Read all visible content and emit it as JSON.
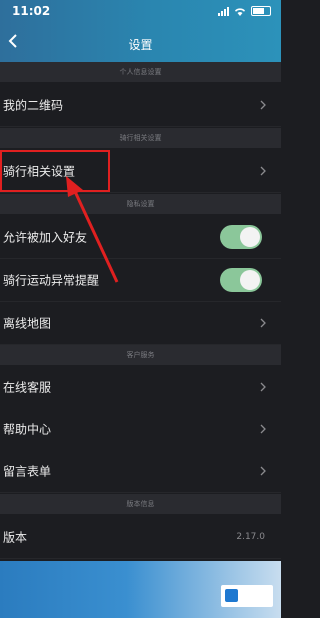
{
  "status": {
    "time": "11:02"
  },
  "header": {
    "title": "设置"
  },
  "sections": {
    "personal": "个人信息设置",
    "riding": "骑行相关设置",
    "privacy": "隐私设置",
    "service": "客户服务",
    "version": "版本信息"
  },
  "rows": {
    "qrcode": "我的二维码",
    "riding_settings": "骑行相关设置",
    "allow_friends": "允许被加入好友",
    "riding_alert": "骑行运动异常提醒",
    "offline_map": "离线地图",
    "online_service": "在线客服",
    "help_center": "帮助中心",
    "message_form": "留言表单",
    "version_label": "版本",
    "version_value": "2.17.0"
  },
  "toggles": {
    "allow_friends": true,
    "riding_alert": true
  },
  "colors": {
    "accent": "#2a86b0",
    "toggle_on": "#8bc79a",
    "highlight": "#e02020"
  }
}
